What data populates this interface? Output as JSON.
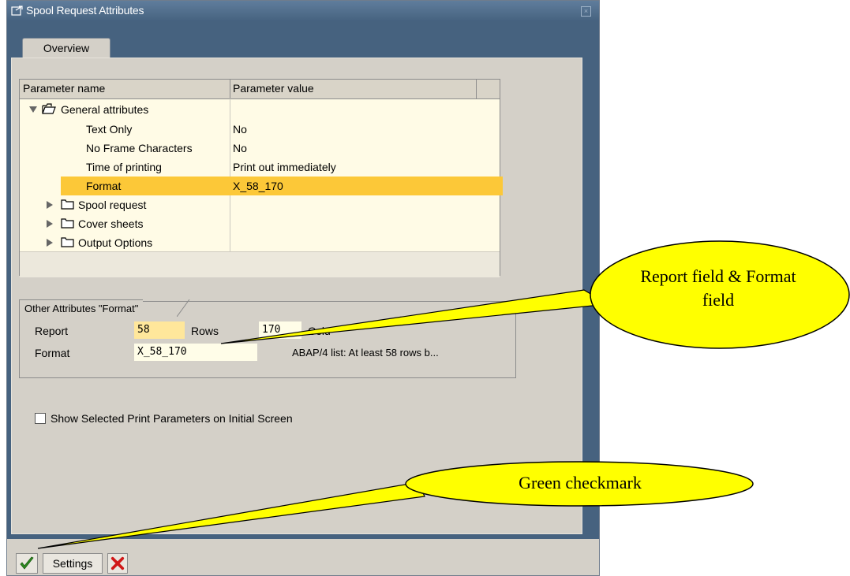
{
  "window": {
    "title": "Spool Request Attributes"
  },
  "tabs": [
    {
      "label": "Overview",
      "active": true
    }
  ],
  "tree": {
    "columns": [
      "Parameter name",
      "Parameter value"
    ],
    "rows": [
      {
        "name": "General attributes",
        "value": "",
        "type": "folder",
        "expanded": true
      },
      {
        "name": "Text Only",
        "value": "No",
        "type": "leaf"
      },
      {
        "name": "No Frame Characters",
        "value": "No",
        "type": "leaf"
      },
      {
        "name": "Time of printing",
        "value": "Print out immediately",
        "type": "leaf"
      },
      {
        "name": "Format",
        "value": "X_58_170",
        "type": "leaf",
        "selected": true
      },
      {
        "name": "Spool request",
        "value": "",
        "type": "folder",
        "expanded": false
      },
      {
        "name": "Cover sheets",
        "value": "",
        "type": "folder",
        "expanded": false
      },
      {
        "name": "Output Options",
        "value": "",
        "type": "folder",
        "expanded": false
      }
    ]
  },
  "other_attributes": {
    "title": "Other Attributes \"Format\"",
    "report_label": "Report",
    "report_value": "58",
    "rows_label": "Rows",
    "rows_value": "170",
    "columns_label_partial": "Colu",
    "format_label": "Format",
    "format_value": "X_58_170",
    "format_description": "ABAP/4 list: At least 58 rows b..."
  },
  "checkbox": {
    "label": "Show Selected Print Parameters on Initial Screen",
    "checked": false
  },
  "buttons": {
    "settings_label": "Settings"
  },
  "callouts": {
    "report_format": "Report field & Format field",
    "checkmark": "Green checkmark"
  },
  "colors": {
    "title_bar": "#5f7d9c",
    "selected_row": "#fcc838",
    "callout_fill": "#ffff00",
    "checkmark_green": "#2e8b1f",
    "cancel_red": "#d01818"
  }
}
